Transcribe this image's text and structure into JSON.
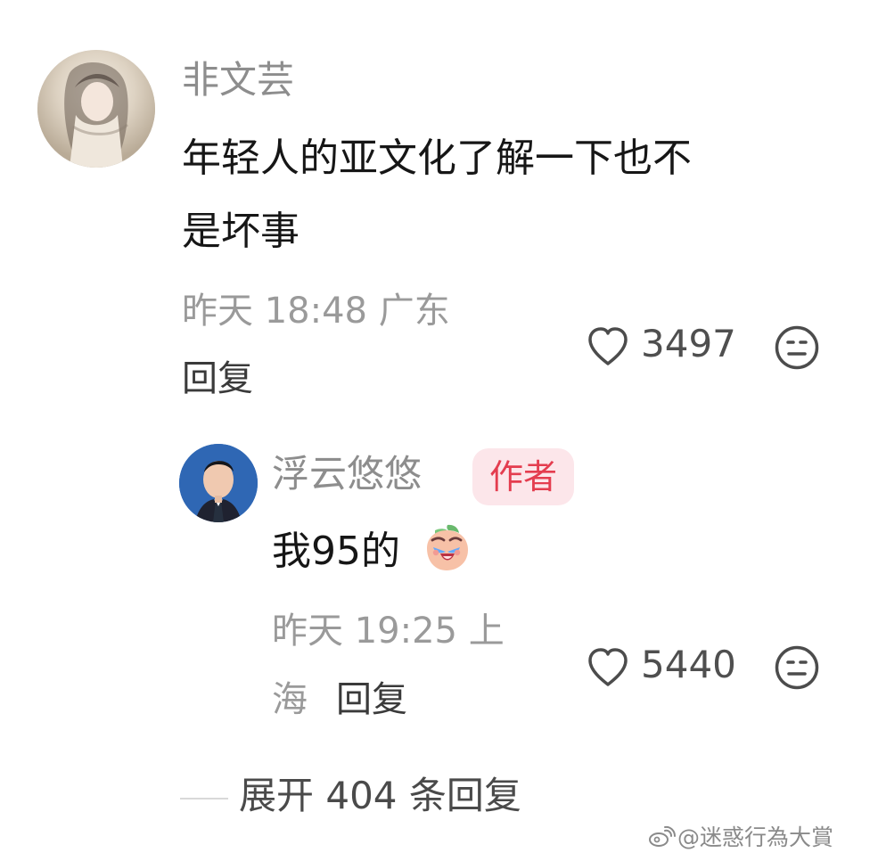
{
  "comment": {
    "username": "非文芸",
    "text_line_1": "年轻人的亚文化了解一下也不",
    "text_line_2": "是坏事",
    "meta": "昨天 18:48 广东",
    "reply_label": "回复",
    "likes": "3497"
  },
  "reply": {
    "username": "浮云悠悠",
    "badge": "作者",
    "text": "我95的",
    "meta_line_1": "昨天 19:25 上",
    "meta_line_2": "海",
    "reply_label": "回复",
    "likes": "5440"
  },
  "footer": {
    "expand_label": "展开 404 条回复"
  },
  "watermark": {
    "text": "@迷惑行為大賞"
  },
  "icons": {
    "heart": "heart-outline-icon",
    "dislike": "meh-face-icon",
    "emoji": "crying-laughing-peach-emoji",
    "weibo": "weibo-icon"
  },
  "colors": {
    "username": "#8d8d8d",
    "text": "#161616",
    "meta": "#9a9a9a",
    "badge_bg": "#fce6ea",
    "badge_text": "#e43d4f"
  }
}
